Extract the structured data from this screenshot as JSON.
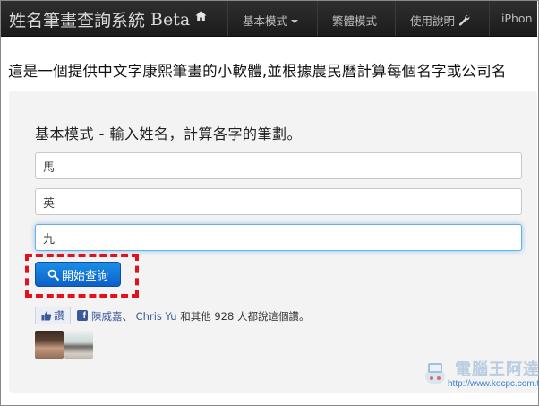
{
  "navbar": {
    "brand_title": "姓名筆畫查詢系統",
    "brand_suffix": "Beta",
    "items": [
      {
        "label": "基本模式"
      },
      {
        "label": "繁體模式"
      },
      {
        "label": "使用說明"
      },
      {
        "label": "iPhon"
      }
    ]
  },
  "headline": "這是一個提供中文字康熙筆畫的小軟體,並根據農民曆計算每個名字或公司名",
  "form": {
    "title": "基本模式 - 輸入姓名，計算各字的筆劃。",
    "fields": [
      {
        "value": "馬"
      },
      {
        "value": "英"
      },
      {
        "value": "九"
      }
    ],
    "submit_label": "開始查詢"
  },
  "social": {
    "like_label": "讚",
    "friend1": "陳威嘉",
    "separator": "、",
    "friend2": "Chris Yu",
    "suffix": "和其他 928 人都說這個讚。"
  },
  "watermark": {
    "title": "電腦王阿達",
    "url": "http://www.kocpc.com.tw"
  },
  "colors": {
    "navbar_bg": "#222222",
    "button_blue": "#0d60c8",
    "highlight_red": "#e0131c",
    "facebook_blue": "#3b5998"
  }
}
